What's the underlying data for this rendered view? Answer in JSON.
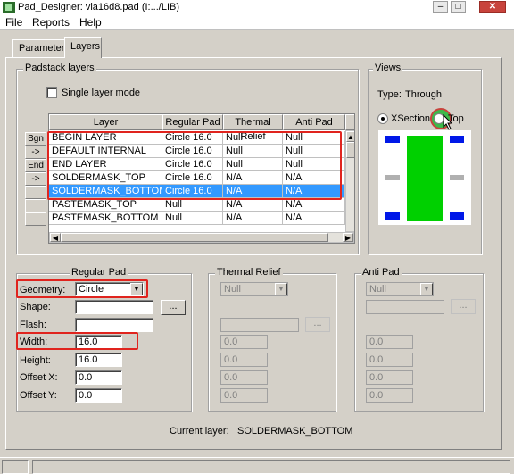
{
  "window": {
    "title": "Pad_Designer: via16d8.pad (I:.../LIB)",
    "min": "–",
    "max": "□",
    "close": "✕"
  },
  "menu": [
    "File",
    "Reports",
    "Help"
  ],
  "tabs": [
    {
      "label": "Parameters"
    },
    {
      "label": "Layers"
    }
  ],
  "padstack": {
    "group_label": "Padstack layers",
    "single_layer_label": "Single layer mode",
    "single_layer_checked": false,
    "columns": [
      "Layer",
      "Regular Pad",
      "Thermal Relief",
      "Anti Pad"
    ],
    "row_buttons": [
      "Bgn",
      "->",
      "End",
      "->",
      "",
      "",
      ""
    ],
    "rows": [
      [
        "BEGIN LAYER",
        "Circle 16.0",
        "Null",
        "Null"
      ],
      [
        "DEFAULT INTERNAL",
        "Circle 16.0",
        "Null",
        "Null"
      ],
      [
        "END LAYER",
        "Circle 16.0",
        "Null",
        "Null"
      ],
      [
        "SOLDERMASK_TOP",
        "Circle 16.0",
        "N/A",
        "N/A"
      ],
      [
        "SOLDERMASK_BOTTOM",
        "Circle 16.0",
        "N/A",
        "N/A"
      ],
      [
        "PASTEMASK_TOP",
        "Null",
        "N/A",
        "N/A"
      ],
      [
        "PASTEMASK_BOTTOM",
        "Null",
        "N/A",
        "N/A"
      ]
    ],
    "selected_row": 4
  },
  "views": {
    "group_label": "Views",
    "type_label": "Type:",
    "type_value": "Through",
    "xsection_label": "XSection",
    "top_label": "Top",
    "selected": "XSection",
    "colors": {
      "pad": "#0018e8",
      "drill": "#00d000",
      "layer": "#b0b0b0"
    }
  },
  "regular_pad": {
    "group_label": "Regular Pad",
    "geometry_label": "Geometry:",
    "geometry_value": "Circle",
    "shape_label": "Shape:",
    "shape_value": "",
    "flash_label": "Flash:",
    "flash_value": "",
    "width_label": "Width:",
    "width_value": "16.0",
    "height_label": "Height:",
    "height_value": "16.0",
    "offset_x_label": "Offset X:",
    "offset_x_value": "0.0",
    "offset_y_label": "Offset Y:",
    "offset_y_value": "0.0",
    "dots": "..."
  },
  "thermal_relief": {
    "group_label": "Thermal Relief",
    "geometry_value": "Null",
    "values": [
      "0.0",
      "0.0",
      "0.0",
      "0.0"
    ],
    "dots": "..."
  },
  "anti_pad": {
    "group_label": "Anti Pad",
    "geometry_value": "Null",
    "values": [
      "0.0",
      "0.0",
      "0.0",
      "0.0"
    ],
    "dots": "..."
  },
  "footer": {
    "current_layer_label": "Current layer:",
    "current_layer_value": "SOLDERMASK_BOTTOM"
  },
  "accent": {
    "annotation_red": "#e0241e",
    "selection_blue": "#3399ff"
  }
}
